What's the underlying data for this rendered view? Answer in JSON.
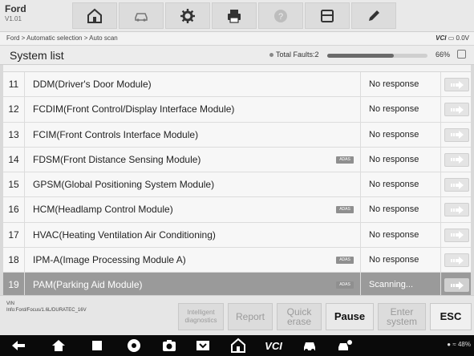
{
  "app": {
    "brand": "Ford",
    "version": "V1.01"
  },
  "toolbar": {
    "items": [
      {
        "name": "home",
        "icon": "home-icon"
      },
      {
        "name": "vehicle-swap",
        "icon": "car-swap-icon"
      },
      {
        "name": "settings",
        "icon": "gear-icon"
      },
      {
        "name": "print",
        "icon": "printer-icon"
      },
      {
        "name": "help",
        "icon": "help-icon"
      },
      {
        "name": "save",
        "icon": "save-icon"
      },
      {
        "name": "edit",
        "icon": "pen-icon"
      }
    ]
  },
  "breadcrumb": "Ford > Automatic selection > Auto scan",
  "vci": {
    "label": "VCI",
    "voltage": "0.0V"
  },
  "system": {
    "title": "System list",
    "faults_label": "Total Faults:2",
    "progress_percent": 66,
    "progress_text": "66%"
  },
  "rows": [
    {
      "num": "11",
      "name": "DDM(Driver's Door Module)",
      "adas": false,
      "status": "No response"
    },
    {
      "num": "12",
      "name": "FCDIM(Front Control/Display Interface Module)",
      "adas": false,
      "status": "No response"
    },
    {
      "num": "13",
      "name": "FCIM(Front Controls Interface Module)",
      "adas": false,
      "status": "No response"
    },
    {
      "num": "14",
      "name": "FDSM(Front Distance Sensing Module)",
      "adas": true,
      "status": "No response"
    },
    {
      "num": "15",
      "name": "GPSM(Global Positioning System Module)",
      "adas": false,
      "status": "No response"
    },
    {
      "num": "16",
      "name": "HCM(Headlamp Control Module)",
      "adas": true,
      "status": "No response"
    },
    {
      "num": "17",
      "name": "HVAC(Heating Ventilation Air Conditioning)",
      "adas": false,
      "status": "No response"
    },
    {
      "num": "18",
      "name": "IPM-A(Image Processing Module A)",
      "adas": true,
      "status": "No response"
    },
    {
      "num": "19",
      "name": "PAM(Parking Aid Module)",
      "adas": true,
      "status": "Scanning..."
    }
  ],
  "adas_label": "ADAS",
  "footer": {
    "vin_label": "VIN",
    "vin_info": "Info:Ford/Focus/1.6L/DURATEC_16V",
    "buttons": {
      "intelligent": "Intelligent diagnostics",
      "report": "Report",
      "quick_erase": "Quick erase",
      "pause": "Pause",
      "enter_system": "Enter system",
      "esc": "ESC"
    }
  },
  "status_bar": {
    "battery": "48%"
  },
  "colors": {
    "active_row": "#9a9a9a",
    "toolbar": "#dcdcdc",
    "navbar": "#0a0a0a"
  }
}
